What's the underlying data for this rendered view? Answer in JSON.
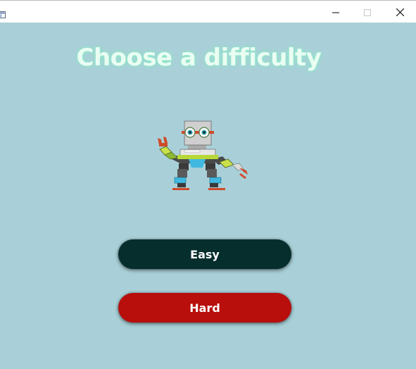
{
  "window": {
    "controls": {
      "minimize_icon": "minimize-icon",
      "maximize_icon": "maximize-icon",
      "close_icon": "close-icon"
    }
  },
  "main": {
    "heading": "Choose a difficulty",
    "buttons": [
      {
        "label": "Easy",
        "color": "#052e2d"
      },
      {
        "label": "Hard",
        "color": "#b80e0c"
      }
    ]
  },
  "colors": {
    "background": "#a9d0d8",
    "heading_text": "#eafdf3",
    "heading_glow": "#8cf0c8"
  }
}
